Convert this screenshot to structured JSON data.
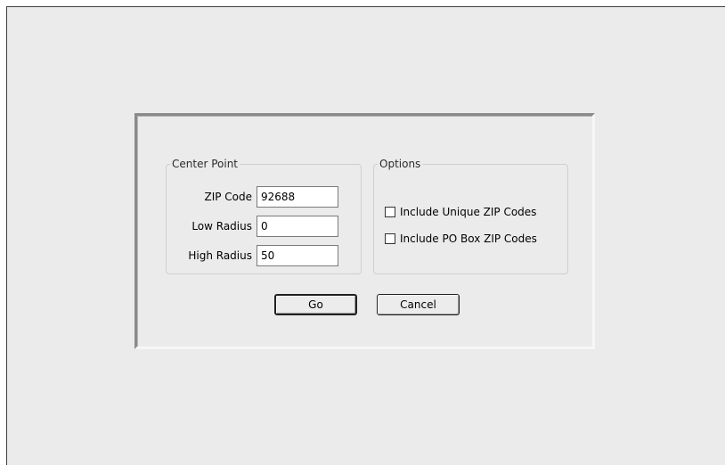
{
  "center_point": {
    "legend": "Center Point",
    "zip_code": {
      "label": "ZIP Code",
      "value": "92688"
    },
    "low_radius": {
      "label": "Low Radius",
      "value": "0"
    },
    "high_radius": {
      "label": "High Radius",
      "value": "50"
    }
  },
  "options": {
    "legend": "Options",
    "include_unique": {
      "label": "Include Unique ZIP Codes",
      "checked": false
    },
    "include_po_box": {
      "label": "Include PO Box ZIP Codes",
      "checked": false
    }
  },
  "buttons": {
    "go_label": "Go",
    "cancel_label": "Cancel"
  }
}
